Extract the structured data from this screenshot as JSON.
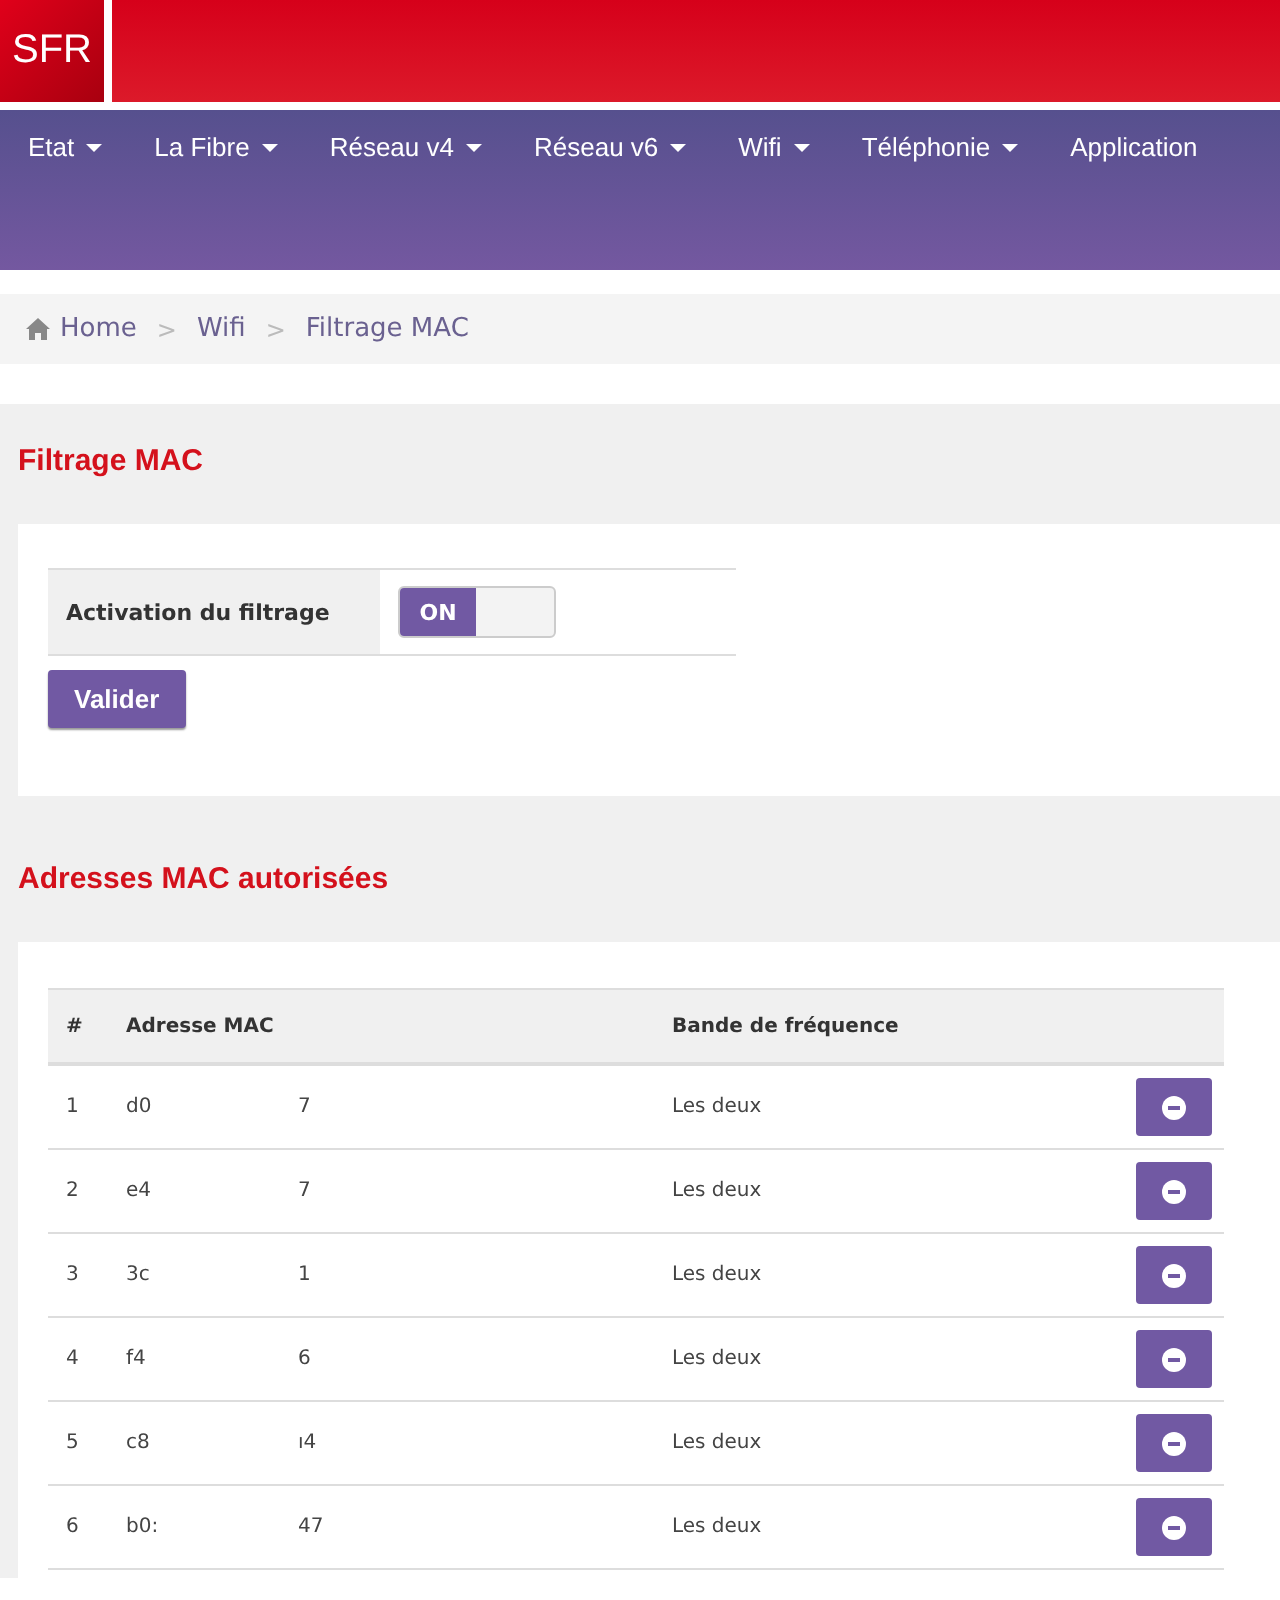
{
  "header": {
    "logo": "SFR"
  },
  "nav": [
    {
      "label": "Etat"
    },
    {
      "label": "La Fibre"
    },
    {
      "label": "Réseau v4"
    },
    {
      "label": "Réseau v6"
    },
    {
      "label": "Wifi"
    },
    {
      "label": "Téléphonie"
    },
    {
      "label": "Application"
    }
  ],
  "breadcrumb": {
    "items": [
      "Home",
      "Wifi",
      "Filtrage MAC"
    ],
    "separator": ">"
  },
  "filter_section": {
    "title": "Filtrage MAC",
    "setting_label": "Activation du filtrage",
    "toggle": {
      "label": "ON",
      "on": true
    },
    "submit": "Valider"
  },
  "mac_section": {
    "title": "Adresses MAC autorisées",
    "columns": [
      "#",
      "Adresse MAC",
      "Bande de fréquence"
    ],
    "rows": [
      {
        "index": "1",
        "mac_parts": [
          "d0",
          "7"
        ],
        "band": "Les deux"
      },
      {
        "index": "2",
        "mac_parts": [
          "e4",
          "7"
        ],
        "band": "Les deux"
      },
      {
        "index": "3",
        "mac_parts": [
          "3c",
          "1"
        ],
        "band": "Les deux"
      },
      {
        "index": "4",
        "mac_parts": [
          "f4",
          "6"
        ],
        "band": "Les deux"
      },
      {
        "index": "5",
        "mac_parts": [
          "c8",
          "ı4"
        ],
        "band": "Les deux"
      },
      {
        "index": "6",
        "mac_parts": [
          "b0:",
          "47"
        ],
        "band": "Les deux"
      }
    ]
  }
}
